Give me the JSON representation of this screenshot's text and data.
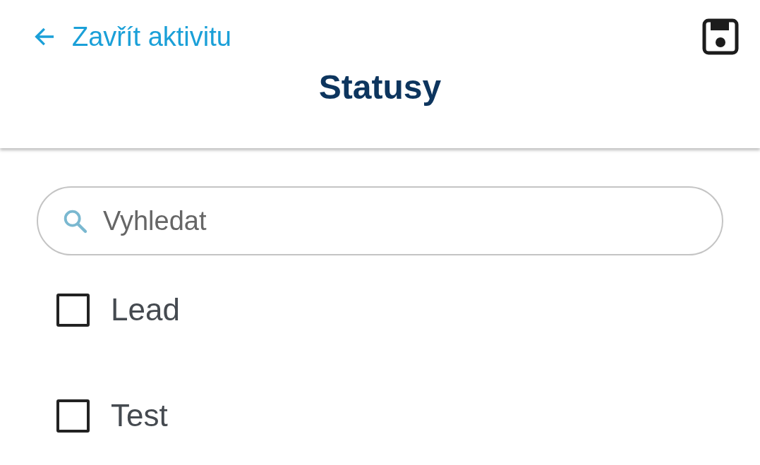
{
  "header": {
    "back_label": "Zavřít aktivitu",
    "title": "Statusy"
  },
  "search": {
    "placeholder": "Vyhledat"
  },
  "items": [
    {
      "label": "Lead",
      "checked": false
    },
    {
      "label": "Test",
      "checked": false
    }
  ]
}
